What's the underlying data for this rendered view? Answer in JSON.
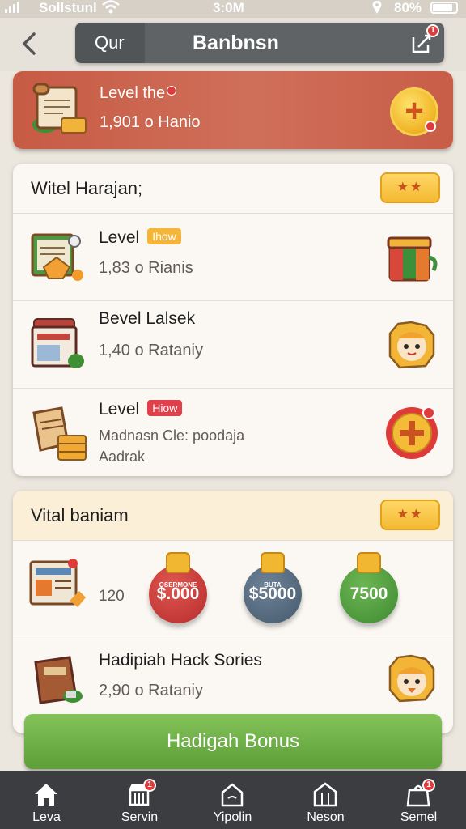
{
  "status": {
    "carrier": "Sollstunl",
    "time": "3:0M",
    "battery": "80%"
  },
  "header": {
    "search_segment": "Qur",
    "title": "Banbnsn",
    "edit_badge": "1"
  },
  "banner": {
    "title": "Level the",
    "subtitle": "1,901 o Hanio"
  },
  "section1": {
    "heading": "Witel Harajan;",
    "rows": [
      {
        "name": "Level",
        "tag": "Ihow",
        "meta": "1,83 o Rianis"
      },
      {
        "name": "Bevel Lalsek",
        "meta": "1,40 o Rataniy"
      },
      {
        "name": "Level",
        "tag": "Hiow",
        "meta": "Madnasn Cle: poodaja",
        "meta2": "Aadrak"
      }
    ]
  },
  "section2": {
    "heading": "Vital baniam",
    "coin_row_count": "120",
    "coins": [
      {
        "label": "$.000",
        "small": "OSERMONE",
        "color": "#c7373a"
      },
      {
        "label": "$5000",
        "small": "BUTA",
        "color": "#4f6275"
      },
      {
        "label": "7500",
        "small": "",
        "color": "#4f9a3c"
      }
    ],
    "rows": [
      {
        "name": "Hadipiah Hack Sories",
        "meta": "2,90 o Rataniy"
      }
    ]
  },
  "bonus_button": "Hadigah Bonus",
  "tabs": [
    {
      "label": "Leva",
      "icon": "home-icon"
    },
    {
      "label": "Servin",
      "icon": "store-icon",
      "badge": "1"
    },
    {
      "label": "Yipolin",
      "icon": "house-outline-icon"
    },
    {
      "label": "Neson",
      "icon": "building-icon"
    },
    {
      "label": "Semel",
      "icon": "bag-icon",
      "badge": "1"
    }
  ],
  "colors": {
    "banner": "#c75b44",
    "bonus": "#6aab42",
    "tabbar": "#3b3d40",
    "accent": "#f4b933"
  }
}
